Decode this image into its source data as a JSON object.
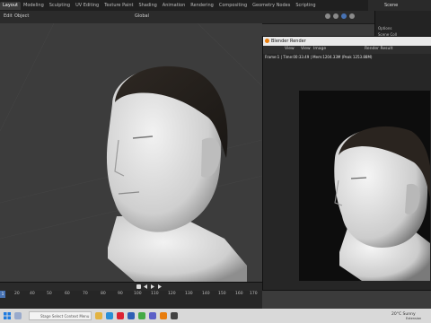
{
  "app": {
    "tabs": [
      "Layout",
      "Modeling",
      "Sculpting",
      "UV Editing",
      "Texture Paint",
      "Shading",
      "Animation",
      "Rendering",
      "Compositing",
      "Geometry Nodes",
      "Scripting"
    ],
    "active_tab": "Layout",
    "scene_label": "Scene"
  },
  "viewport_header": {
    "mode_left": "Edit",
    "object_menu": "Object",
    "transform": "Global",
    "options_label": "Options"
  },
  "outliner": {
    "rows": [
      "Scene Coll",
      "Collecti"
    ]
  },
  "render_window": {
    "title": "Blender Render",
    "menu": {
      "view": "View",
      "view2": "View",
      "image": "Image",
      "result": "Render Result"
    },
    "status": "Frame:1 | Time:00:33.49 | Mem:1204.33M (Peak 1253.88M)"
  },
  "timeline": {
    "frame_label": "1",
    "ticks": [
      "20",
      "40",
      "50",
      "60",
      "70",
      "80",
      "90",
      "100",
      "110",
      "120",
      "130",
      "140",
      "150",
      "160",
      "170",
      "18"
    ]
  },
  "taskbar": {
    "search_placeholder": "Type here to search",
    "tooltip": "Stage Select Context Menu",
    "weather": "20°C  Sunny",
    "status_extra": "Extension"
  },
  "colors": {
    "accent": "#4772b3",
    "blender_orange": "#e87d0d",
    "viewport_bg": "#3c3c3c",
    "taskbar_bg": "#d9d9d9"
  }
}
